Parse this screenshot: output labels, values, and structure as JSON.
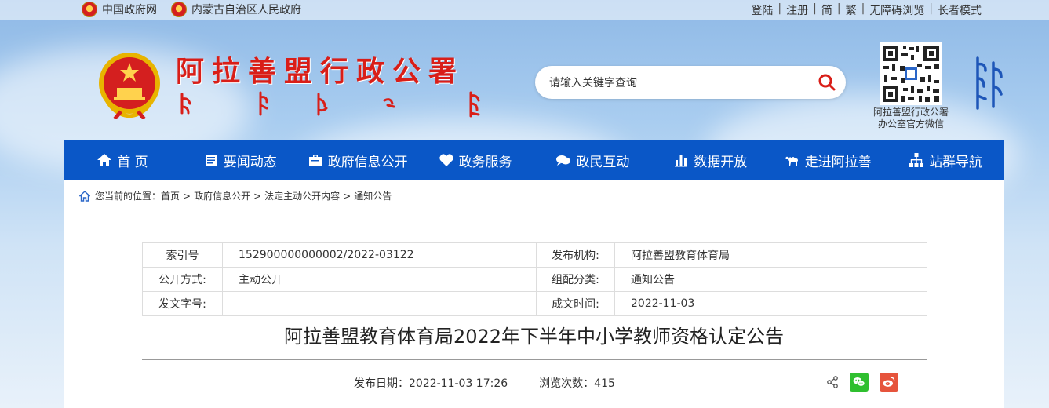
{
  "topbar": {
    "links_left": [
      "中国政府网",
      "内蒙古自治区人民政府"
    ],
    "links_right": [
      "登陆",
      "注册",
      "简",
      "繁",
      "无障碍浏览",
      "长者模式"
    ]
  },
  "header": {
    "title": "阿拉善盟行政公署",
    "search_placeholder": "请输入关键字查询",
    "qr_caption_line1": "阿拉善盟行政公署",
    "qr_caption_line2": "办公室官方微信"
  },
  "nav": {
    "items": [
      {
        "label": "首 页",
        "icon": "home-icon"
      },
      {
        "label": "要闻动态",
        "icon": "news-icon"
      },
      {
        "label": "政府信息公开",
        "icon": "info-icon"
      },
      {
        "label": "政务服务",
        "icon": "service-icon"
      },
      {
        "label": "政民互动",
        "icon": "chat-icon"
      },
      {
        "label": "数据开放",
        "icon": "chart-icon"
      },
      {
        "label": "走进阿拉善",
        "icon": "camel-icon"
      },
      {
        "label": "站群导航",
        "icon": "sitemap-icon"
      }
    ]
  },
  "breadcrumb": {
    "prefix": "您当前的位置：",
    "items": [
      "首页",
      "政府信息公开",
      "法定主动公开内容",
      "通知公告"
    ]
  },
  "meta": {
    "rows": [
      {
        "l1": "索引号",
        "v1": "152900000000002/2022-03122",
        "l2": "发布机构:",
        "v2": "阿拉善盟教育体育局"
      },
      {
        "l1": "公开方式:",
        "v1": "主动公开",
        "l2": "组配分类:",
        "v2": "通知公告"
      },
      {
        "l1": "发文字号:",
        "v1": "",
        "l2": "成文时间:",
        "v2": "2022-11-03"
      }
    ]
  },
  "document": {
    "title": "阿拉善盟教育体育局2022年下半年中小学教师资格认定公告",
    "publish_date": "发布日期：2022-11-03 17:26",
    "views": "浏览次数：415"
  },
  "colors": {
    "nav_bg": "#0a57c7",
    "title_red": "#d91e18",
    "wechat": "#2fbf2f",
    "weibo": "#e6543c"
  }
}
